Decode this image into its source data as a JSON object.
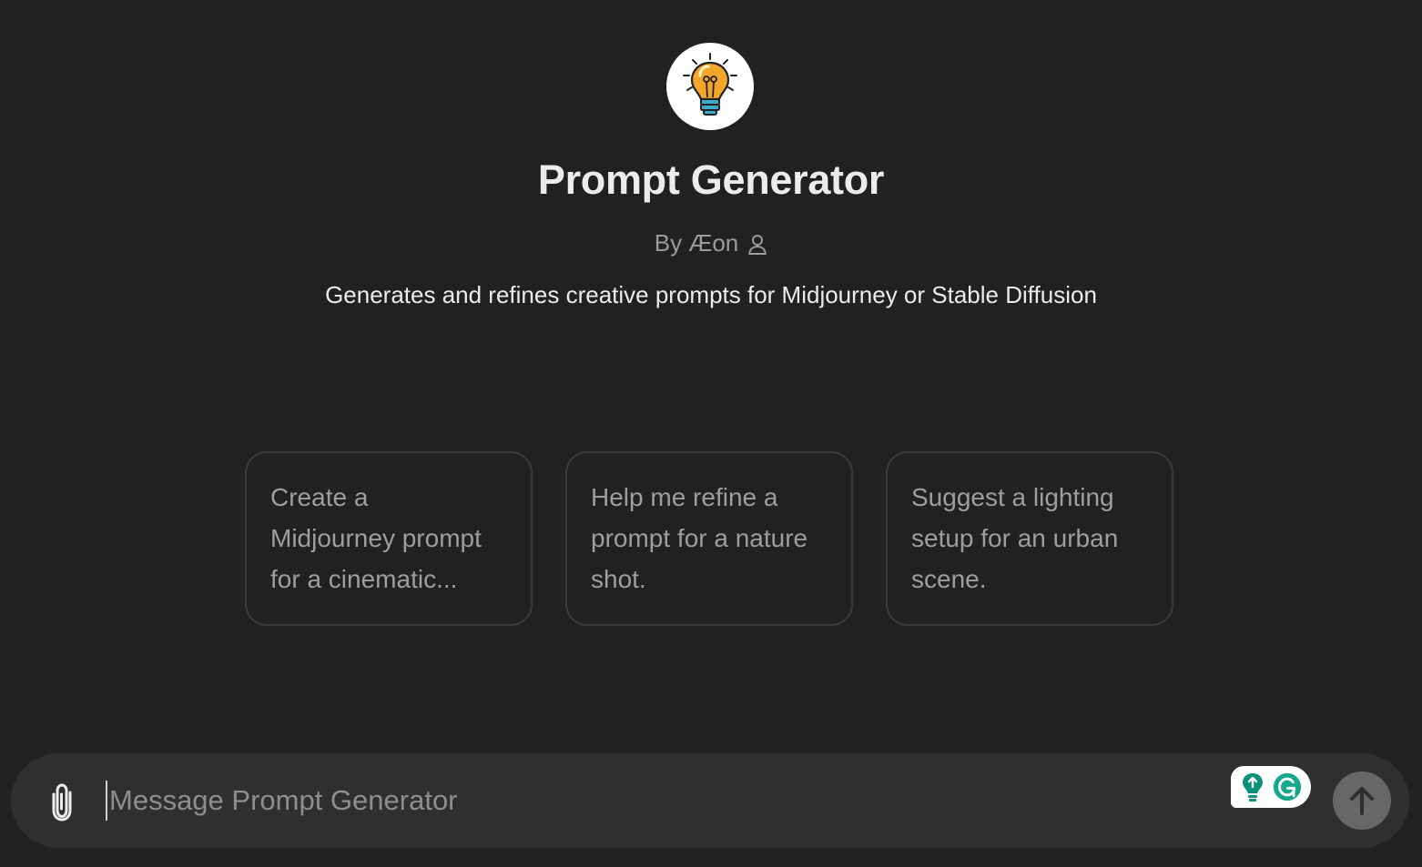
{
  "gpt": {
    "avatar_icon": "lightbulb-icon",
    "name": "Prompt Generator",
    "author": "By Æon",
    "author_icon": "person-icon",
    "description": "Generates and refines creative prompts for Midjourney or Stable Diffusion"
  },
  "starters": [
    {
      "text": "Create a Midjourney prompt for a cinematic..."
    },
    {
      "text": "Help me refine a prompt for a nature shot."
    },
    {
      "text": "Suggest a lighting setup for an urban scene."
    }
  ],
  "composer": {
    "placeholder": "Message Prompt Generator",
    "value": "",
    "attach_icon": "paperclip-icon",
    "grammarly_icon": "grammarly-icon",
    "send_icon": "arrow-up-icon"
  },
  "colors": {
    "background": "#212121",
    "composer_bg": "#2f2f2f",
    "send_button": "#676767",
    "bulb": "#f4a62a",
    "grammarly": "#15c39a"
  }
}
